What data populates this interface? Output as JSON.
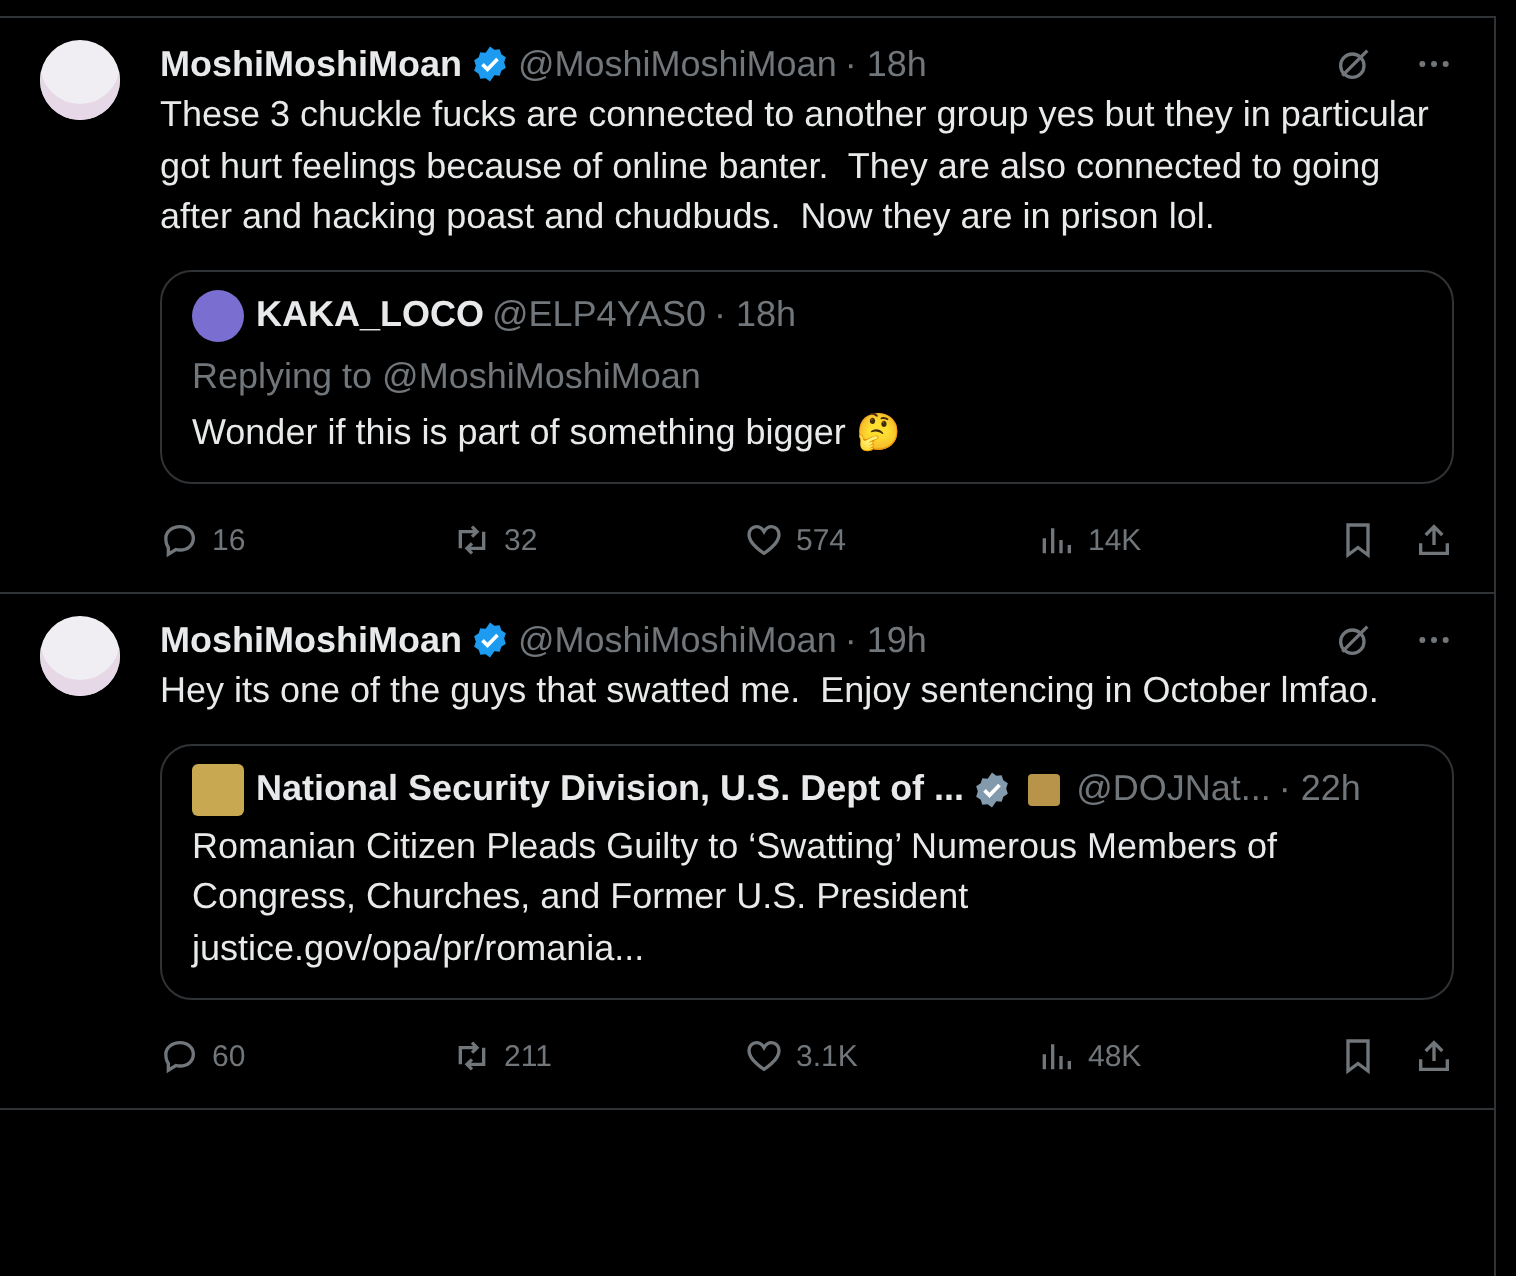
{
  "tweets": [
    {
      "name": "MoshiMoshiMoan",
      "verified": true,
      "handle": "@MoshiMoshiMoan",
      "time": "· 18h",
      "text": "These 3 chuckle fucks are connected to another group yes but they in particular got hurt feelings because of online banter.  They are also connected to going after and hacking poast and chudbuds.  Now they are in prison lol.",
      "quote": {
        "square_avatar": false,
        "name": "KAKA_LOCO",
        "verified": false,
        "handle": "@ELP4YAS0",
        "time": "· 18h",
        "replying_to": "Replying to @MoshiMoshiMoan",
        "text": "Wonder if this is part of something bigger 🤔"
      },
      "stats": {
        "replies": "16",
        "reposts": "32",
        "likes": "574",
        "views": "14K"
      }
    },
    {
      "name": "MoshiMoshiMoan",
      "verified": true,
      "handle": "@MoshiMoshiMoan",
      "time": "· 19h",
      "text": "Hey its one of the guys that swatted me.  Enjoy sentencing in October lmfao.",
      "quote": {
        "square_avatar": true,
        "name": "National Security Division, U.S. Dept of ...",
        "verified": true,
        "government": true,
        "affiliate": true,
        "handle": "@DOJNat...",
        "time": "· 22h",
        "text": "Romanian Citizen Pleads Guilty to ‘Swatting’ Numerous Members of Congress, Churches, and Former U.S. President",
        "link": "justice.gov/opa/pr/romania..."
      },
      "stats": {
        "replies": "60",
        "reposts": "211",
        "likes": "3.1K",
        "views": "48K"
      }
    }
  ]
}
